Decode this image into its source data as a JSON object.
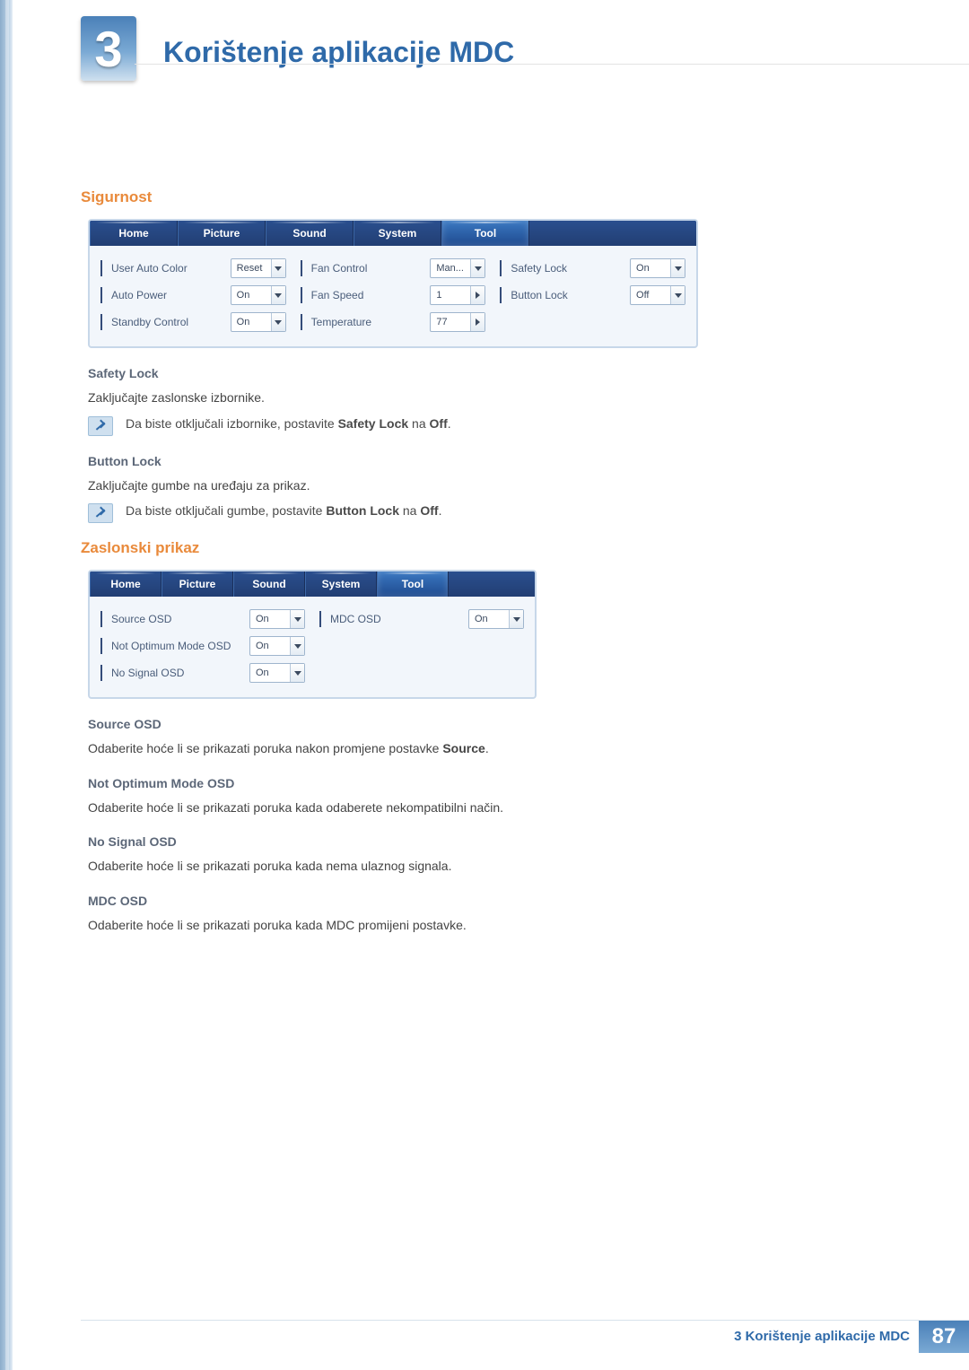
{
  "chapter": {
    "number": "3",
    "title": "Korištenje aplikacije MDC"
  },
  "section_sigurnost": {
    "heading": "Sigurnost",
    "panel": {
      "tabs": [
        "Home",
        "Picture",
        "Sound",
        "System",
        "Tool"
      ],
      "active_tab_index": 4,
      "cols": [
        {
          "rows": [
            {
              "label": "User Auto Color",
              "value": "Reset",
              "type": "dd"
            },
            {
              "label": "Auto Power",
              "value": "On",
              "type": "dd"
            },
            {
              "label": "Standby Control",
              "value": "On",
              "type": "dd"
            }
          ]
        },
        {
          "rows": [
            {
              "label": "Fan Control",
              "value": "Man...",
              "type": "dd"
            },
            {
              "label": "Fan Speed",
              "value": "1",
              "type": "spin"
            },
            {
              "label": "Temperature",
              "value": "77",
              "type": "spin"
            }
          ]
        },
        {
          "rows": [
            {
              "label": "Safety Lock",
              "value": "On",
              "type": "dd"
            },
            {
              "label": "Button Lock",
              "value": "Off",
              "type": "dd"
            }
          ]
        }
      ]
    },
    "safety_lock": {
      "h": "Safety Lock",
      "p": "Zaključajte zaslonske izbornike.",
      "note_pre": "Da biste otključali izbornike, postavite ",
      "note_b1": "Safety Lock",
      "note_mid": " na ",
      "note_b2": "Off",
      "note_post": "."
    },
    "button_lock": {
      "h": "Button Lock",
      "p": "Zaključajte gumbe na uređaju za prikaz.",
      "note_pre": "Da biste otključali gumbe, postavite ",
      "note_b1": "Button Lock",
      "note_mid": " na ",
      "note_b2": "Off",
      "note_post": "."
    }
  },
  "section_zaslon": {
    "heading": "Zaslonski prikaz",
    "panel": {
      "tabs": [
        "Home",
        "Picture",
        "Sound",
        "System",
        "Tool"
      ],
      "active_tab_index": 4,
      "cols": [
        {
          "rows": [
            {
              "label": "Source OSD",
              "value": "On",
              "type": "dd"
            },
            {
              "label": "Not Optimum Mode OSD",
              "value": "On",
              "type": "dd"
            },
            {
              "label": "No Signal OSD",
              "value": "On",
              "type": "dd"
            }
          ]
        },
        {
          "rows": [
            {
              "label": "MDC OSD",
              "value": "On",
              "type": "dd"
            }
          ]
        }
      ]
    },
    "items": [
      {
        "h": "Source OSD",
        "pre": "Odaberite hoće li se prikazati poruka nakon promjene postavke ",
        "b": "Source",
        "post": "."
      },
      {
        "h": "Not Optimum Mode OSD",
        "p": "Odaberite hoće li se prikazati poruka kada odaberete nekompatibilni način."
      },
      {
        "h": "No Signal OSD",
        "p": "Odaberite hoće li se prikazati poruka kada nema ulaznog signala."
      },
      {
        "h": "MDC OSD",
        "p": "Odaberite hoće li se prikazati poruka kada MDC promijeni postavke."
      }
    ]
  },
  "footer": {
    "text": "3 Korištenje aplikacije MDC",
    "page": "87"
  }
}
